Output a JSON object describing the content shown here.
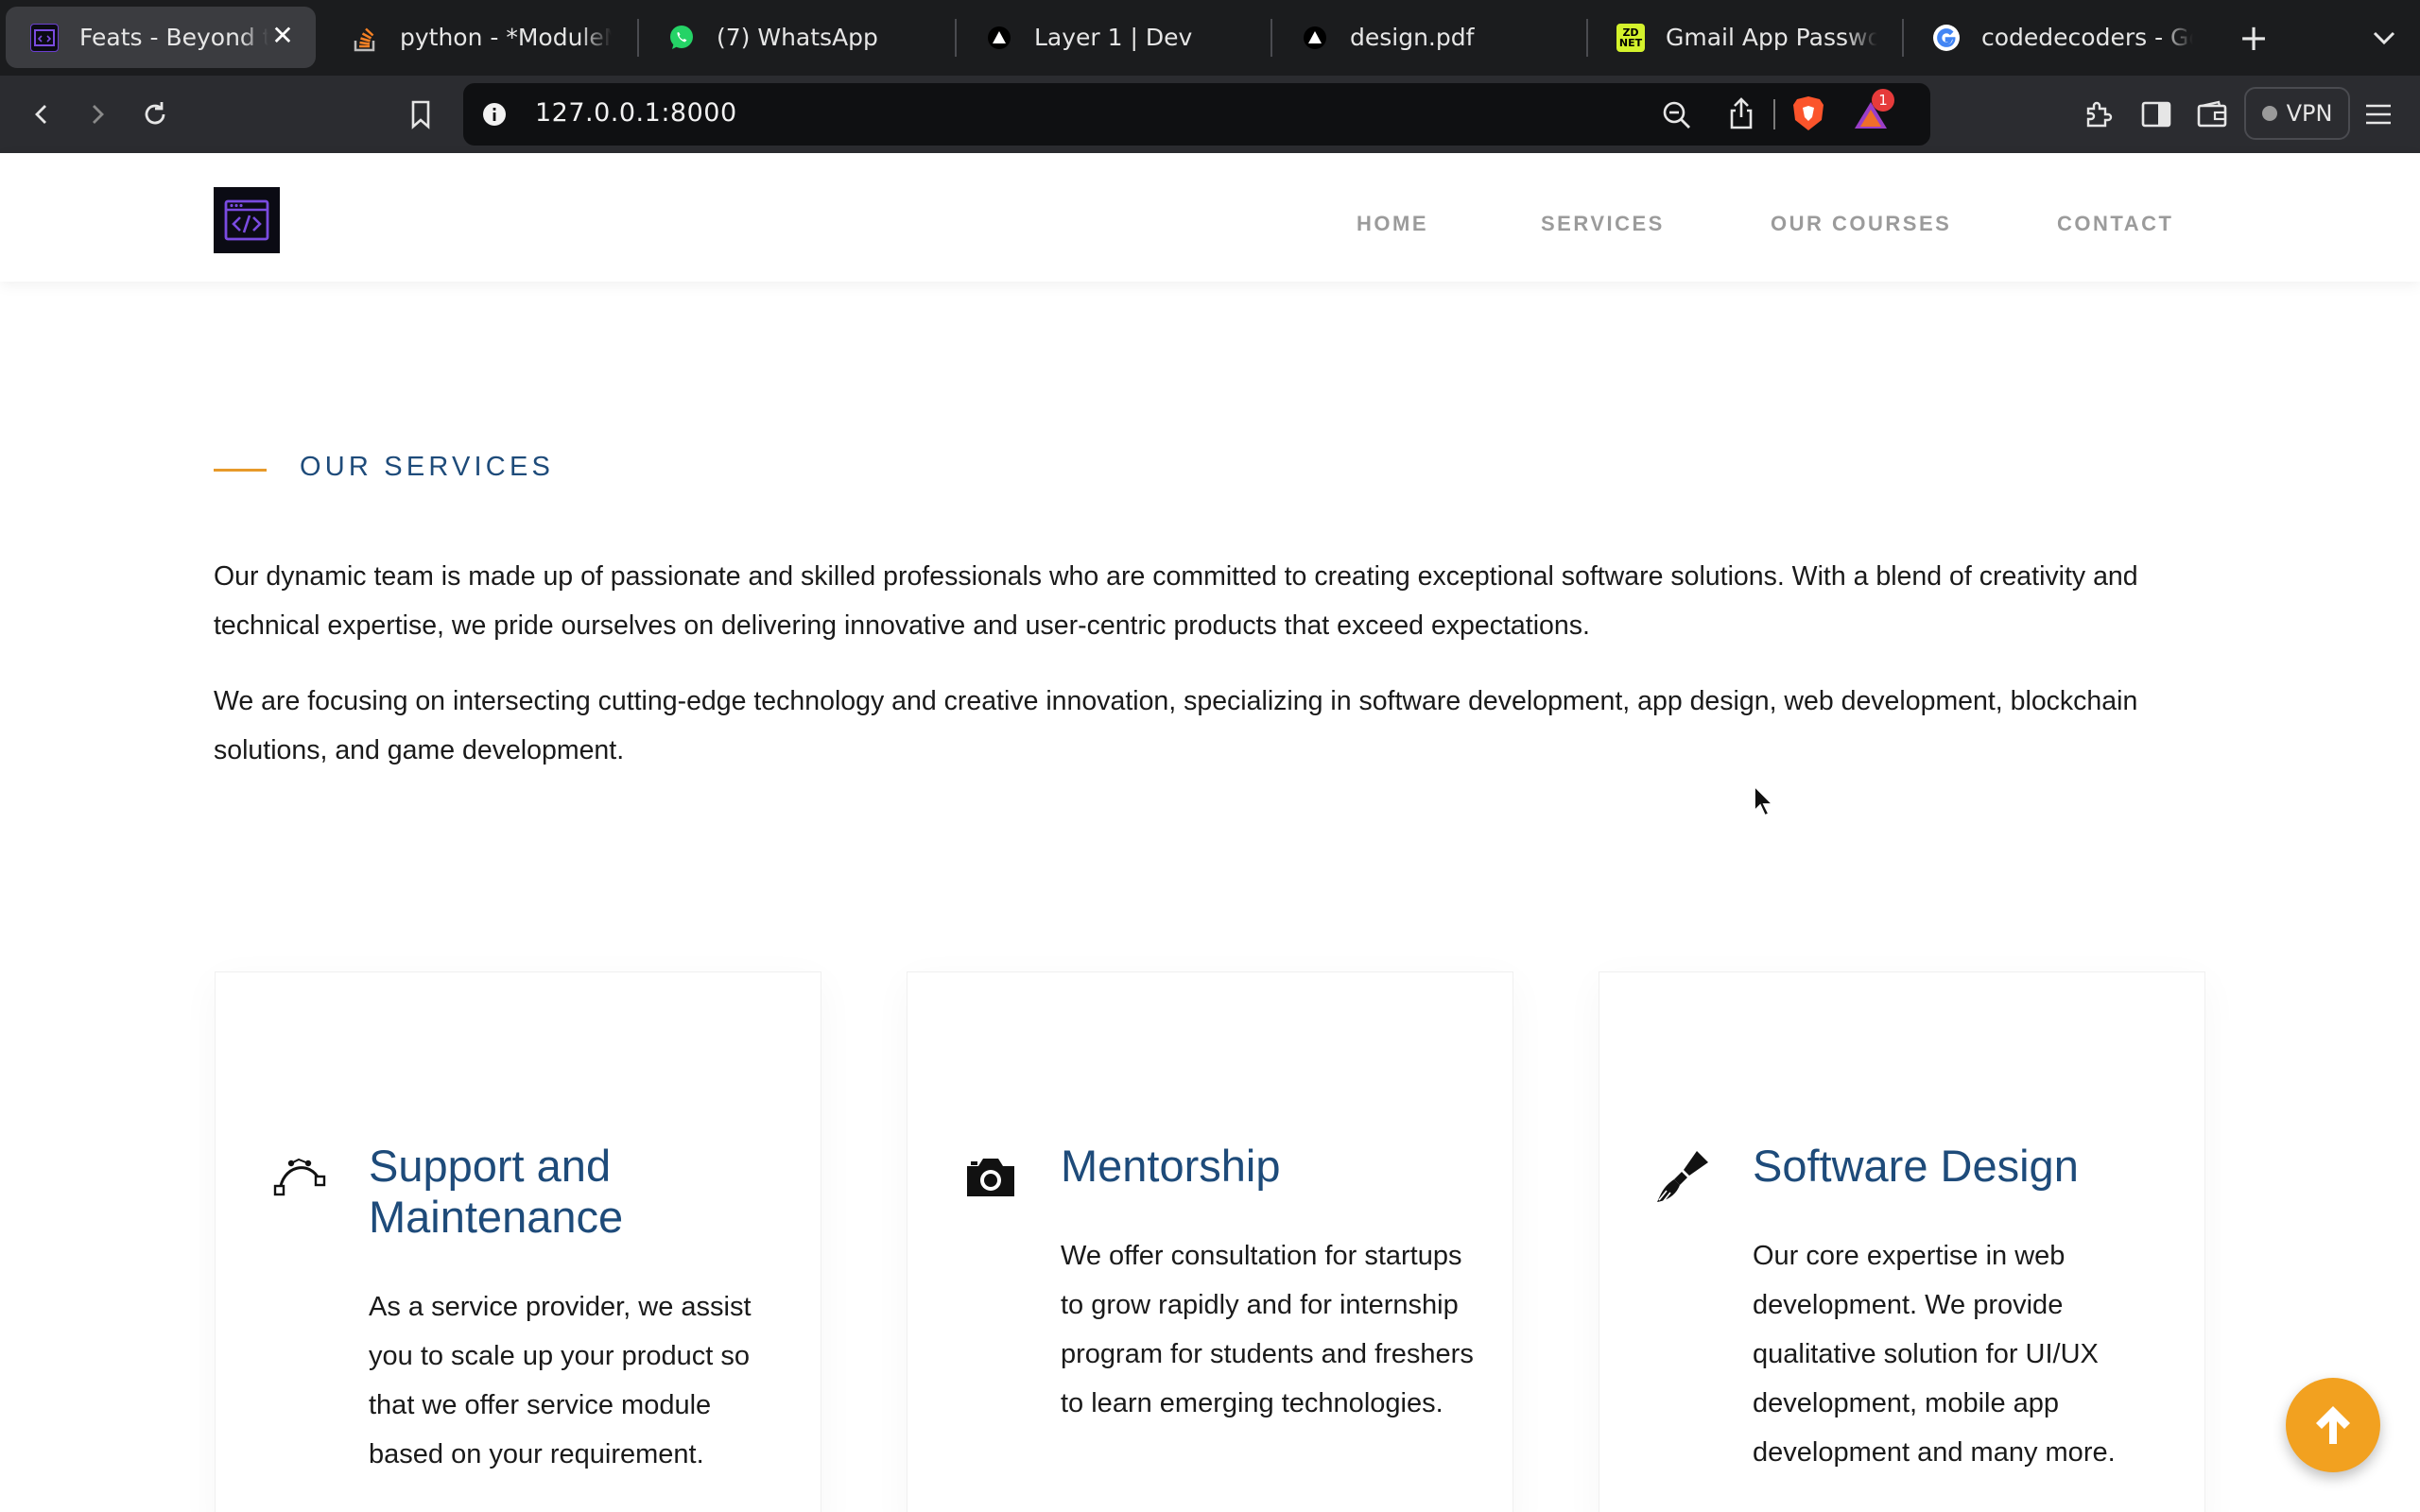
{
  "browser": {
    "tabs": [
      {
        "title": "Feats - Beyond the Obvious",
        "active": true
      },
      {
        "title": "python - *ModuleNotFoundError*"
      },
      {
        "title": "(7) WhatsApp"
      },
      {
        "title": "Layer 1 | Dev"
      },
      {
        "title": "design.pdf"
      },
      {
        "title": "Gmail App Passwords"
      },
      {
        "title": "codedecoders - Google"
      }
    ],
    "url": "127.0.0.1:8000",
    "badge_count": "1",
    "vpn_label": "VPN"
  },
  "site": {
    "nav": [
      "HOME",
      "SERVICES",
      "OUR COURSES",
      "CONTACT"
    ],
    "section_heading": "OUR SERVICES",
    "paragraphs": [
      "Our dynamic team is made up of passionate and skilled professionals who are committed to creating exceptional software solutions. With a blend of creativity and technical expertise, we pride ourselves on delivering innovative and user-centric products that exceed expectations.",
      "We are focusing on intersecting cutting-edge technology and creative innovation, specializing in software development, app design, web development, blockchain solutions, and game development."
    ],
    "cards": [
      {
        "icon": "bezier-curve-icon",
        "title": "Support and Maintenance",
        "text": "As a service provider, we assist you to scale up your product so that we offer service module based on your requirement."
      },
      {
        "icon": "camera-icon",
        "title": "Mentorship",
        "text": "We offer consultation for startups to grow rapidly and for internship program for students and freshers to learn emerging technologies."
      },
      {
        "icon": "paintbrush-icon",
        "title": "Software Design",
        "text": "Our core expertise in web development. We provide qualitative solution for UI/UX development, mobile app development and many more."
      }
    ]
  },
  "colors": {
    "heading_blue": "#1e4b7a",
    "accent_orange": "#f2a120",
    "tabbar_bg": "#1b1c1e",
    "toolbar_bg": "#2b2c30"
  }
}
